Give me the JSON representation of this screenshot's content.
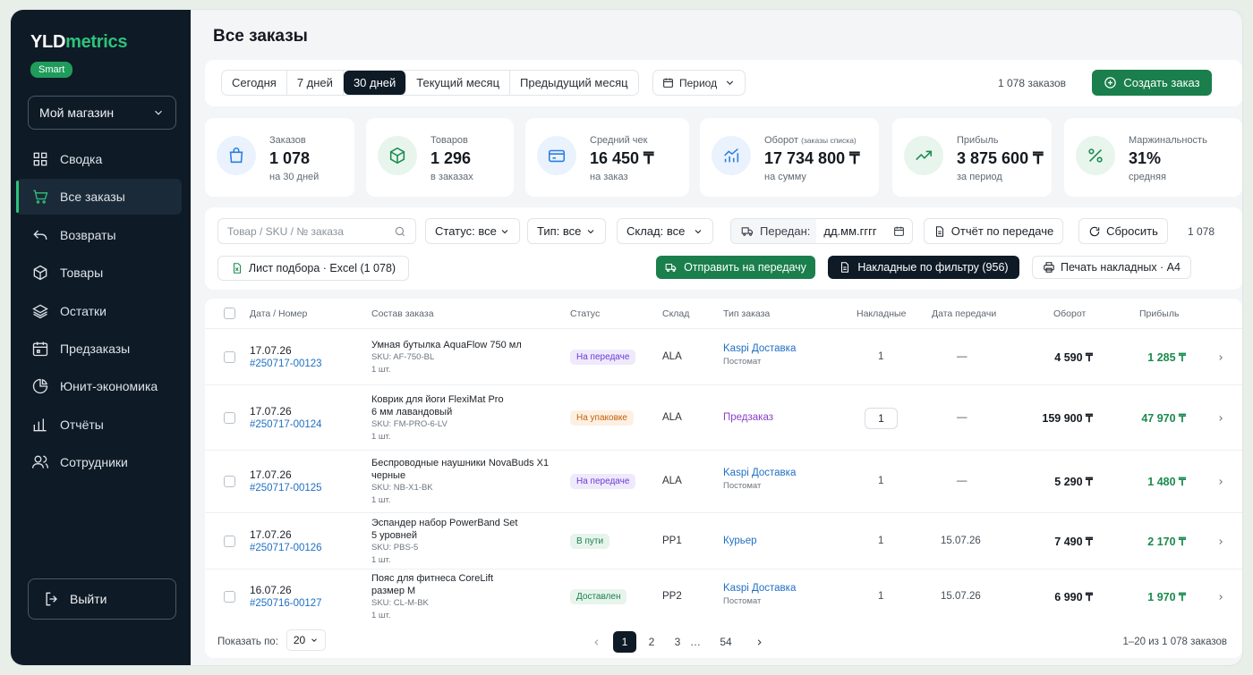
{
  "brand": {
    "name_a": "YLD",
    "name_b": "metrics",
    "badge": "Smart"
  },
  "store": {
    "label": "Мой магазин"
  },
  "nav": [
    {
      "label": "Сводка",
      "icon": "grid-icon"
    },
    {
      "label": "Все заказы",
      "icon": "cart-icon"
    },
    {
      "label": "Возвраты",
      "icon": "return-arrow-icon"
    },
    {
      "label": "Товары",
      "icon": "box-icon"
    },
    {
      "label": "Остатки",
      "icon": "layers-icon"
    },
    {
      "label": "Предзаказы",
      "icon": "calendar-icon"
    },
    {
      "label": "Юнит-экономика",
      "icon": "pie-chart-icon"
    },
    {
      "label": "Отчёты",
      "icon": "bar-chart-icon"
    },
    {
      "label": "Сотрудники",
      "icon": "users-icon"
    }
  ],
  "logout": "Выйти",
  "page_title": "Все заказы",
  "periods": [
    "Сегодня",
    "7 дней",
    "30 дней",
    "Текущий месяц",
    "Предыдущий месяц"
  ],
  "period_active": "30 дней",
  "period_picker": "Период",
  "orders_count": "1 078 заказов",
  "create_button": "Создать заказ",
  "stats": [
    {
      "label": "Заказов",
      "label_small": "",
      "value": "1 078",
      "sub": "на 30 дней",
      "icon": "bag-icon",
      "color": "#2b7de0",
      "bg": "#eaf2fd"
    },
    {
      "label": "Товаров",
      "label_small": "",
      "value": "1 296",
      "sub": "в заказах",
      "icon": "cube-icon",
      "color": "#1a8a4e",
      "bg": "#e7f5ed"
    },
    {
      "label": "Средний чек",
      "label_small": "",
      "value": "16 450 ₸",
      "sub": "на заказ",
      "icon": "card-icon",
      "color": "#2b7de0",
      "bg": "#eaf2fd"
    },
    {
      "label": "Оборот",
      "label_small": "(заказы списка)",
      "value": "17 734 800 ₸",
      "sub": "на сумму",
      "icon": "chart-up-icon",
      "color": "#2b7de0",
      "bg": "#eaf2fd"
    },
    {
      "label": "Прибыль",
      "label_small": "",
      "value": "3 875 600 ₸",
      "sub": "за период",
      "icon": "trend-icon",
      "color": "#1a8a4e",
      "bg": "#e7f5ed"
    },
    {
      "label": "Маржинальность",
      "label_small": "",
      "value": "31%",
      "sub": "средняя",
      "icon": "percent-icon",
      "color": "#1a8a4e",
      "bg": "#e7f5ed"
    }
  ],
  "filters": {
    "search_placeholder": "Товар / SKU / № заказа",
    "status": "Статус: все",
    "type": "Тип: все",
    "warehouse": "Склад: все",
    "transfer_label": "Передан:",
    "transfer_date": "дд.мм.гггг",
    "report": "Отчёт по передаче",
    "reset": "Сбросить",
    "count": "1 078",
    "picklist": "Лист подбора · Excel (1 078)",
    "send": "Отправить на передачу",
    "invoices": "Накладные по фильтру (956)",
    "print": "Печать накладных · A4"
  },
  "columns": [
    "Дата / Номер",
    "Состав заказа",
    "Статус",
    "Склад",
    "Тип заказа",
    "Накладные",
    "Дата передачи",
    "Оборот",
    "Прибыль"
  ],
  "rows": [
    {
      "date": "17.07.26",
      "number": "#250717-00123",
      "name": [
        "Умная бутылка AquaFlow 750 мл"
      ],
      "sku": "SKU: AF-750-BL",
      "qty": "1 шт.",
      "status": "На передаче",
      "status_fg": "#6a3bd6",
      "status_bg": "#efe9fc",
      "wh": "ALA",
      "type": "Kaspi Доставка",
      "type_color": "#1f6fc4",
      "type_sub": "Постомат",
      "inv": "1",
      "inv_box": false,
      "tdate": "—",
      "rev": "4 590 ₸",
      "prof": "1 285 ₸"
    },
    {
      "date": "17.07.26",
      "number": "#250717-00124",
      "name": [
        "Коврик для йоги FlexiMat Pro",
        "6 мм лавандовый"
      ],
      "sku": "SKU: FM-PRO-6-LV",
      "qty": "1 шт.",
      "status": "На упаковке",
      "status_fg": "#c2620c",
      "status_bg": "#fdf0e3",
      "wh": "ALA",
      "type": "Предзаказ",
      "type_color": "#8b3fc7",
      "type_sub": "",
      "inv": "1",
      "inv_box": true,
      "tdate": "—",
      "rev": "159 900 ₸",
      "prof": "47 970 ₸"
    },
    {
      "date": "17.07.26",
      "number": "#250717-00125",
      "name": [
        "Беспроводные наушники NovaBuds X1",
        "черные"
      ],
      "sku": "SKU: NB-X1-BK",
      "qty": "1 шт.",
      "status": "На передаче",
      "status_fg": "#6a3bd6",
      "status_bg": "#efe9fc",
      "wh": "ALA",
      "type": "Kaspi Доставка",
      "type_color": "#1f6fc4",
      "type_sub": "Постомат",
      "inv": "1",
      "inv_box": false,
      "tdate": "—",
      "rev": "5 290 ₸",
      "prof": "1 480 ₸"
    },
    {
      "date": "17.07.26",
      "number": "#250717-00126",
      "name": [
        "Эспандер набор PowerBand Set",
        "5 уровней"
      ],
      "sku": "SKU: PBS-5",
      "qty": "1 шт.",
      "status": "В пути",
      "status_fg": "#1a7f4c",
      "status_bg": "#e6f4ec",
      "wh": "PP1",
      "type": "Курьер",
      "type_color": "#1f6fc4",
      "type_sub": "",
      "inv": "1",
      "inv_box": false,
      "tdate": "15.07.26",
      "rev": "7 490 ₸",
      "prof": "2 170 ₸"
    },
    {
      "date": "16.07.26",
      "number": "#250716-00127",
      "name": [
        "Пояс для фитнеса CoreLift",
        "размер M"
      ],
      "sku": "SKU: CL-M-BK",
      "qty": "1 шт.",
      "status": "Доставлен",
      "status_fg": "#1a7f4c",
      "status_bg": "#e6f4ec",
      "wh": "PP2",
      "type": "Kaspi Доставка",
      "type_color": "#1f6fc4",
      "type_sub": "Постомат",
      "inv": "1",
      "inv_box": false,
      "tdate": "15.07.26",
      "rev": "6 990 ₸",
      "prof": "1 970 ₸"
    }
  ],
  "pagination": {
    "show_label": "Показать по:",
    "page_size": "20",
    "pages": [
      "1",
      "2",
      "3",
      "…",
      "54"
    ],
    "current": "1",
    "range": "1–20 из 1 078 заказов"
  }
}
